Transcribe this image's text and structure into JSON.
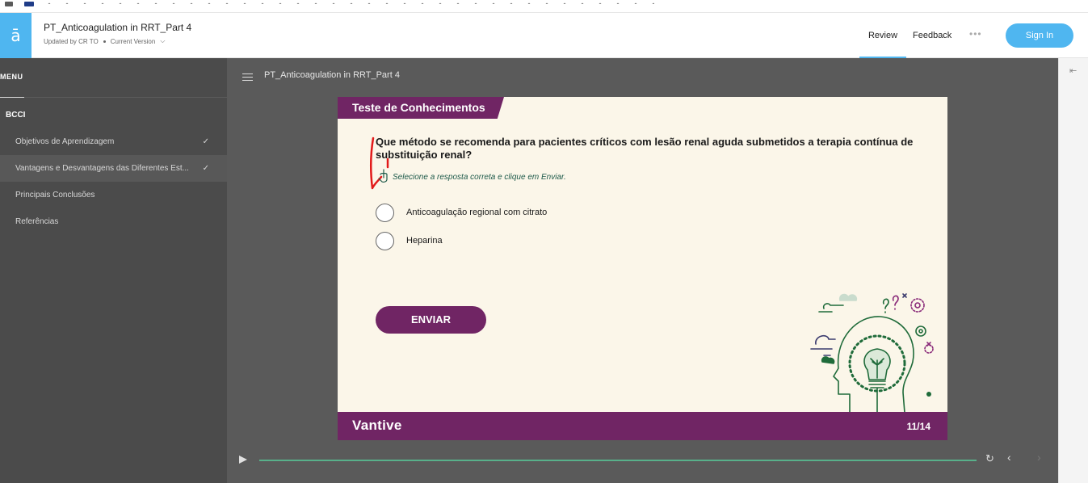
{
  "header": {
    "logo_glyph": "ā",
    "course_title": "PT_Anticoagulation in RRT_Part 4",
    "updated_by": "Updated by CR TO",
    "version": "Current Version",
    "review": "Review",
    "feedback": "Feedback",
    "more": "•••",
    "sign_in": "Sign In"
  },
  "sidebar": {
    "menu_label": "MENU",
    "section": "BCCI",
    "items": [
      {
        "label": "Objetivos de Aprendizagem",
        "completed": true
      },
      {
        "label": "Vantagens e Desvantagens das Diferentes Est...",
        "completed": true,
        "active": true
      },
      {
        "label": "Principais Conclusões",
        "completed": false
      },
      {
        "label": "Referências",
        "completed": false
      }
    ],
    "check_glyph": "✓"
  },
  "content": {
    "title": "PT_Anticoagulation in RRT_Part 4"
  },
  "slide": {
    "tab_title": "Teste de Conhecimentos",
    "question": "Que método se recomenda para pacientes críticos com lesão renal aguda submetidos a terapia contínua de substituição renal?",
    "instruction": "Selecione a resposta correta e clique em Enviar.",
    "options": [
      "Anticoagulação regional com citrato",
      "Heparina"
    ],
    "submit": "ENVIAR",
    "brand": "Vantive",
    "page": "11/14"
  },
  "player": {
    "progress": 1.0,
    "replay_glyph": "↻",
    "prev_glyph": "‹",
    "next_glyph": "›"
  },
  "colors": {
    "accent": "#4fb6f0",
    "brand_purple": "#702564",
    "progress_green": "#58b08a",
    "slide_bg": "#fbf6e9"
  },
  "icons": [
    "menu-icon",
    "chevron-down-icon",
    "check-icon",
    "collapse-panel-icon",
    "cursor-hint-icon",
    "lightbulb-head-illustration",
    "play-icon",
    "replay-icon",
    "chevron-left-icon",
    "chevron-right-icon"
  ]
}
